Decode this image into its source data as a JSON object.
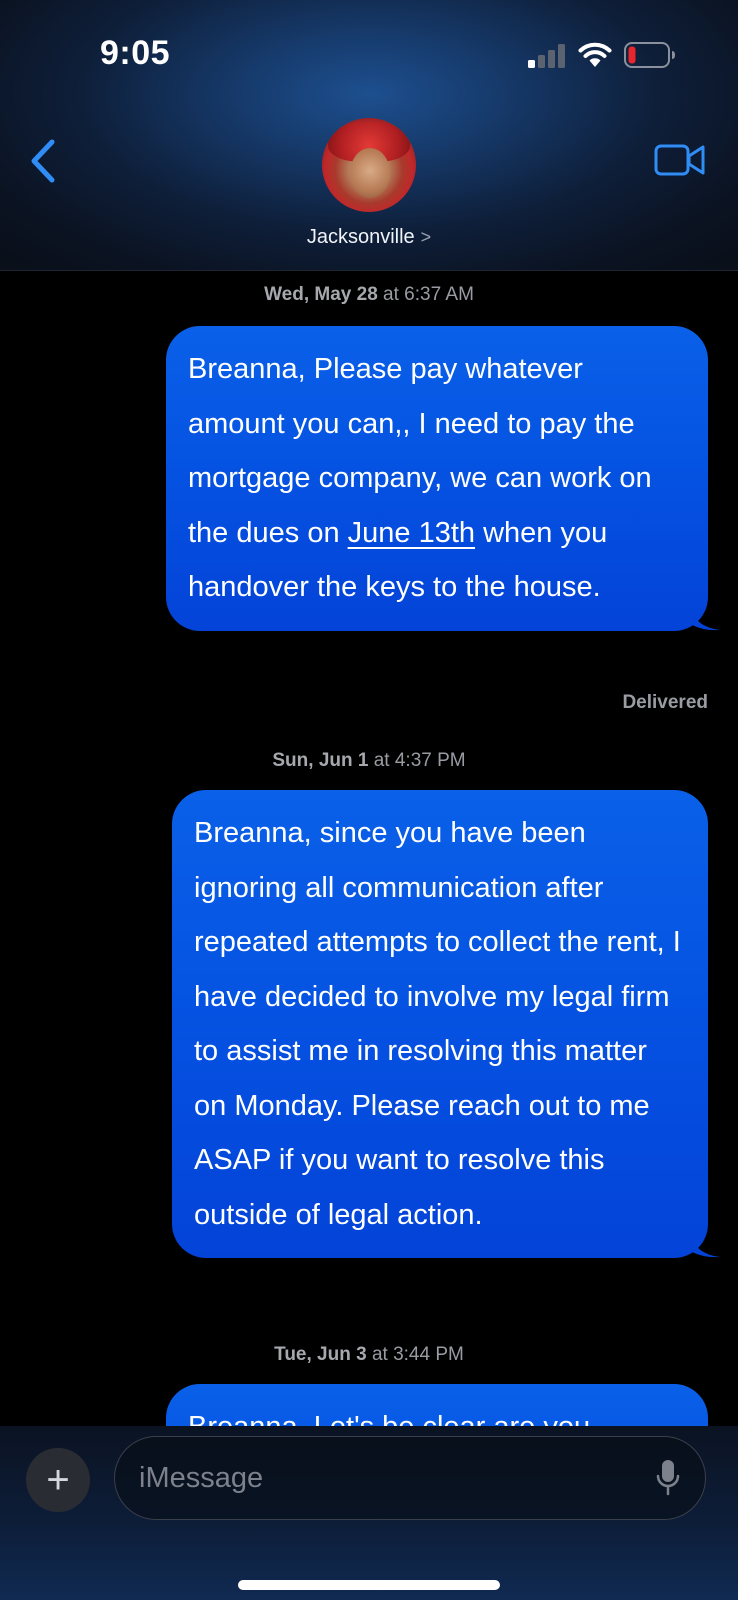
{
  "status_bar": {
    "time": "9:05"
  },
  "header": {
    "contact_name": "Jacksonville",
    "contact_chevron": ">"
  },
  "messages": [
    {
      "timestamp_day": "Wed, May 28",
      "timestamp_rest": " at 6:37 AM",
      "text_before_link": "Breanna, Please pay whatever amount you can,, I need to pay the mortgage company, we can work on the dues on ",
      "link_text": "June 13th",
      "text_after_link": " when you handover the keys to the house.",
      "status": "Delivered"
    },
    {
      "timestamp_day": "Sun, Jun 1",
      "timestamp_rest": " at 4:37 PM",
      "text": "Breanna, since you have been ignoring all communication after repeated attempts to collect the rent, I have decided to involve my legal firm to assist me in resolving this matter on Monday. Please reach out to me ASAP if you want to resolve this outside of legal action."
    },
    {
      "timestamp_day": "Tue, Jun 3",
      "timestamp_rest": " at 3:44 PM",
      "text": "Breanna, Let's be clear are you"
    }
  ],
  "composer": {
    "plus_label": "+",
    "placeholder": "iMessage"
  },
  "colors": {
    "bubble_blue": "#0553e2",
    "accent_blue": "#2f8df5",
    "background": "#000000"
  },
  "icons": [
    "signal-icon",
    "wifi-icon",
    "battery-icon",
    "back-chevron-icon",
    "video-camera-icon",
    "plus-icon",
    "microphone-icon"
  ]
}
